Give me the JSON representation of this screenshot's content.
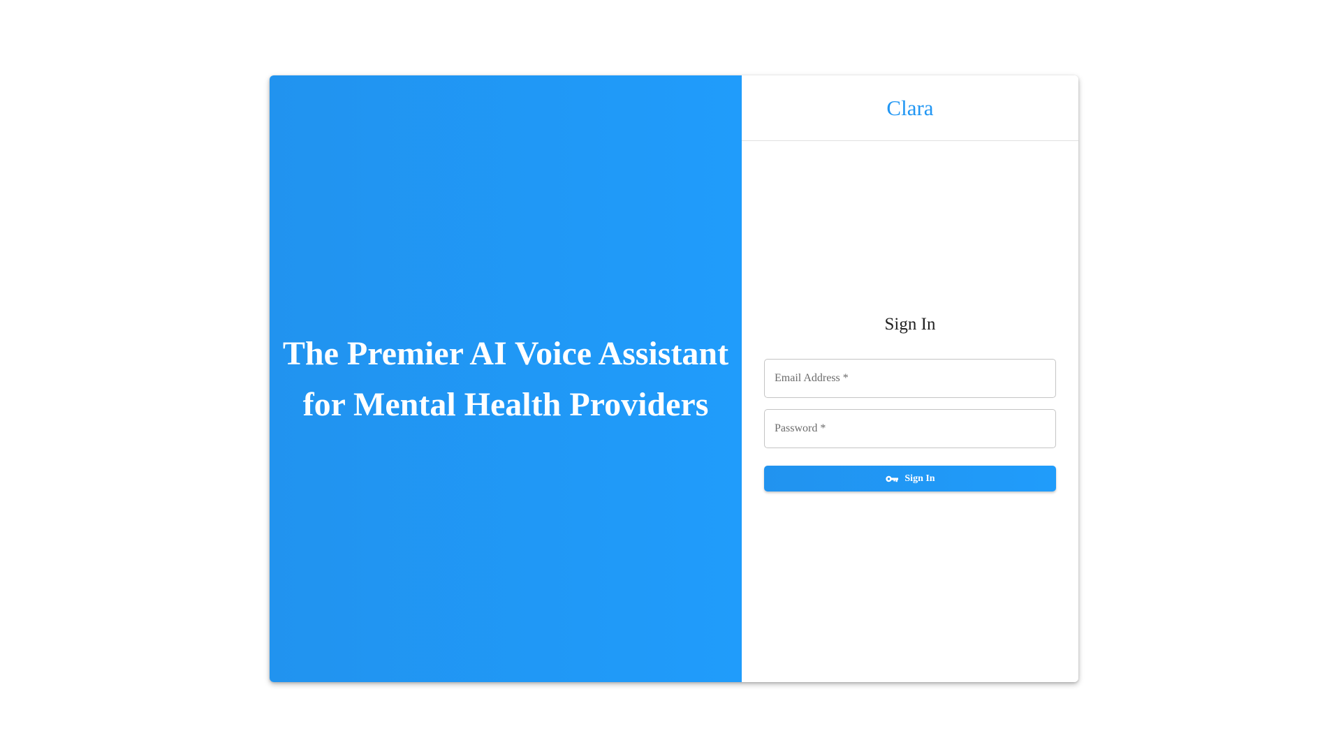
{
  "hero": {
    "headline_line1": "The Premier AI Voice Assistant",
    "headline_line2": "for Mental Health Providers"
  },
  "header": {
    "brand": "Clara"
  },
  "form": {
    "title": "Sign In",
    "email_placeholder": "Email Address *",
    "password_placeholder": "Password *",
    "submit_label": "Sign In",
    "submit_icon": "key-icon"
  },
  "colors": {
    "accent": "#2196f3",
    "hero_gradient_start": "#2193ef",
    "hero_gradient_end": "#209cfb"
  }
}
